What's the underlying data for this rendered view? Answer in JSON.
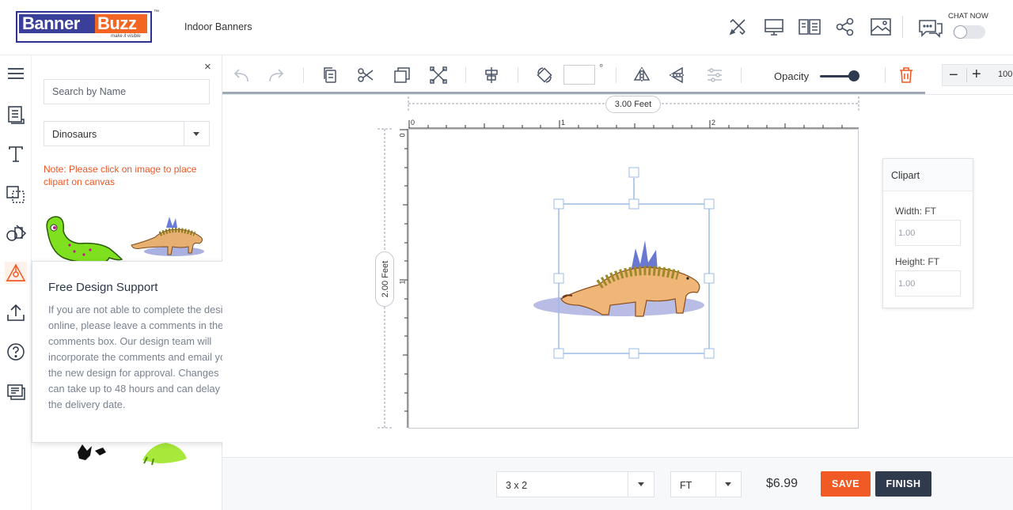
{
  "brand": {
    "logo_left": "Banner",
    "logo_right": "Buzz",
    "tagline": "make it visible",
    "trademark": "™"
  },
  "header": {
    "product_name": "Indoor Banners",
    "icons": [
      "design-tools-icon",
      "preview-desktop-icon",
      "book-icon",
      "share-icon",
      "image-icon",
      "chat-icon"
    ],
    "chat_label": "CHAT NOW",
    "chat_enabled": false
  },
  "rail": {
    "items": [
      "menu-icon",
      "template-icon",
      "text-icon",
      "shapes-icon",
      "objects-icon",
      "clipart-icon",
      "upload-icon",
      "help-icon",
      "comments-icon"
    ],
    "active": "clipart-icon"
  },
  "panel": {
    "close_label": "×",
    "search_placeholder": "Search by Name",
    "category_selected": "Dinosaurs",
    "note": "Note: Please click on image to place clipart on canvas"
  },
  "support_popup": {
    "title": "Free Design Support",
    "close_label": "×",
    "body": "If you are not able to complete the design online, please leave a comments in the comments box. Our design team will incorporate the comments and email you the new design for approval. Changes can take up to 48 hours and can delay the delivery date."
  },
  "toolbar": {
    "rotate_value": "",
    "degree_symbol": "°",
    "opacity_label": "Opacity",
    "opacity_value": 1.0,
    "zoom_minus": "−",
    "zoom_plus": "+",
    "zoom_value": "100"
  },
  "canvas": {
    "width_label": "3.00 Feet",
    "height_label": "2.00 Feet",
    "ruler_x": [
      "0",
      "1",
      "2"
    ],
    "ruler_y": [
      "0",
      "1"
    ]
  },
  "clipart_props": {
    "title": "Clipart",
    "width_label": "Width: FT",
    "width_value": "1.00",
    "height_label": "Height: FT",
    "height_value": "1.00"
  },
  "footer": {
    "size_selected": "3 x 2",
    "unit_selected": "FT",
    "price": "$6.99",
    "save_label": "SAVE",
    "finish_label": "FINISH"
  },
  "colors": {
    "accent": "#f15a24",
    "dark": "#2f3a4c",
    "note": "#ee5522",
    "selection": "#9bbbe8"
  }
}
